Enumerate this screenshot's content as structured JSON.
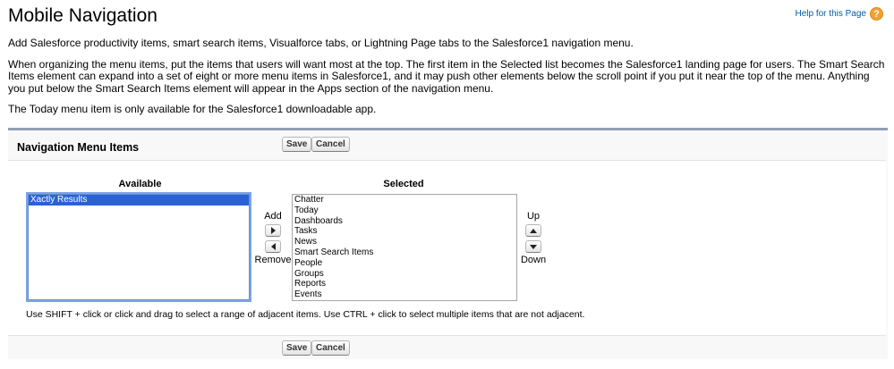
{
  "header": {
    "title": "Mobile Navigation",
    "help_label": "Help for this Page",
    "help_icon": "?"
  },
  "intro": {
    "p1": "Add Salesforce productivity items, smart search items, Visualforce tabs, or Lightning Page tabs to the Salesforce1 navigation menu.",
    "p2": "When organizing the menu items, put the items that users will want most at the top. The first item in the Selected list becomes the Salesforce1 landing page for users. The Smart Search Items element can expand into a set of eight or more menu items in Salesforce1, and it may push other elements below the scroll point if you put it near the top of the menu. Anything you put below the Smart Search Items element will appear in the Apps section of the navigation menu.",
    "p3": "The Today menu item is only available for the Salesforce1 downloadable app."
  },
  "panel": {
    "title": "Navigation Menu Items",
    "save_label": "Save",
    "cancel_label": "Cancel",
    "available_label": "Available",
    "selected_label": "Selected",
    "available_items": [
      "Xactly Results"
    ],
    "selected_items": [
      "Chatter",
      "Today",
      "Dashboards",
      "Tasks",
      "News",
      "Smart Search Items",
      "People",
      "Groups",
      "Reports",
      "Events"
    ],
    "add_label": "Add",
    "remove_label": "Remove",
    "up_label": "Up",
    "down_label": "Down",
    "hint": "Use SHIFT + click or click and drag to select a range of adjacent items. Use CTRL + click to select multiple items that are not adjacent."
  },
  "colors": {
    "panel_border": "#939eb6",
    "link": "#015ba7",
    "help_icon": "#f3a12e",
    "selection": "#2a62d6"
  }
}
